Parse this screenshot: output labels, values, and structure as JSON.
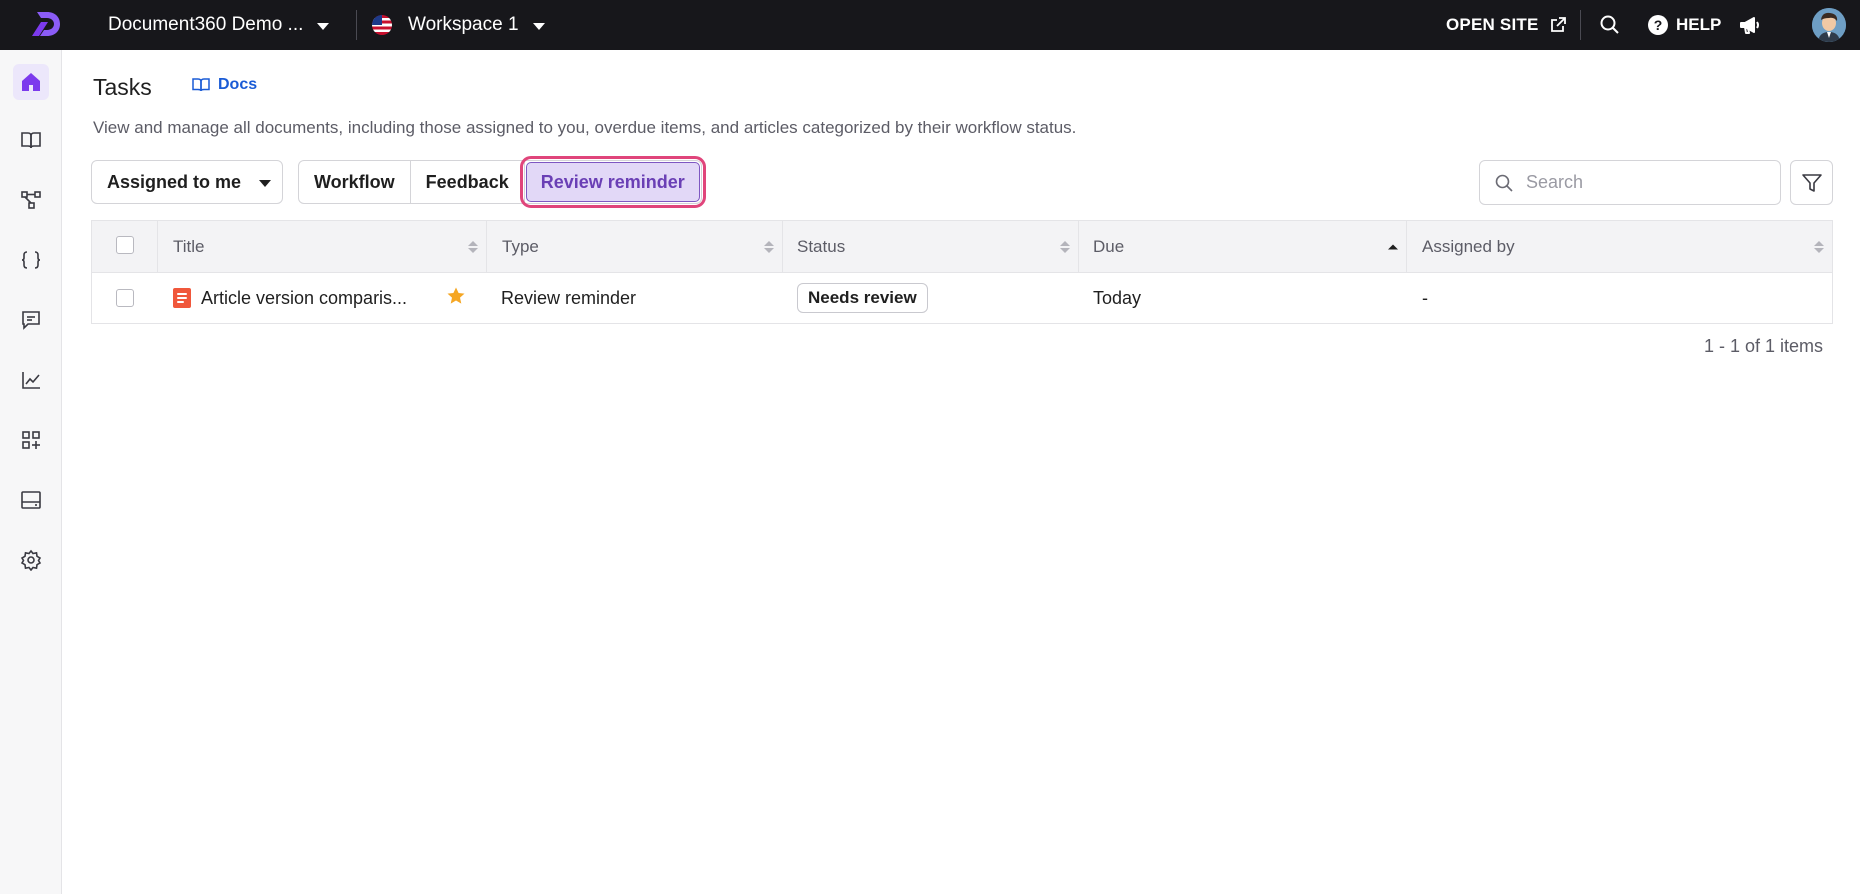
{
  "topbar": {
    "project_name": "Document360 Demo ...",
    "workspace_name": "Workspace 1",
    "open_site_label": "OPEN SITE",
    "help_label": "HELP",
    "colors": {
      "background": "#17171b",
      "brand": "#7c3aed"
    }
  },
  "sidebar": {
    "items": [
      {
        "icon": "home-icon",
        "active": true
      },
      {
        "icon": "book-icon",
        "active": false
      },
      {
        "icon": "api-diagram-icon",
        "active": false
      },
      {
        "icon": "code-braces-icon",
        "active": false
      },
      {
        "icon": "feedback-chat-icon",
        "active": false
      },
      {
        "icon": "analytics-icon",
        "active": false
      },
      {
        "icon": "apps-add-icon",
        "active": false
      },
      {
        "icon": "widget-panel-icon",
        "active": false
      },
      {
        "icon": "settings-gear-icon",
        "active": false
      }
    ]
  },
  "page": {
    "title": "Tasks",
    "docs_link": "Docs",
    "description": "View and manage all documents, including those assigned to you, overdue items, and articles categorized by their workflow status."
  },
  "filters": {
    "assigned_select": "Assigned to me",
    "tabs": [
      {
        "label": "Workflow",
        "selected": false
      },
      {
        "label": "Feedback",
        "selected": false
      },
      {
        "label": "Review reminder",
        "selected": true
      }
    ],
    "search_placeholder": "Search"
  },
  "table": {
    "columns": [
      "Title",
      "Type",
      "Status",
      "Due",
      "Assigned by"
    ],
    "sorted_column": "Due",
    "rows": [
      {
        "title": "Article version comparis...",
        "starred": true,
        "type": "Review reminder",
        "status": "Needs review",
        "due": "Today",
        "assigned_by": "-"
      }
    ]
  },
  "pagination": {
    "summary": "1 - 1 of 1 items"
  }
}
